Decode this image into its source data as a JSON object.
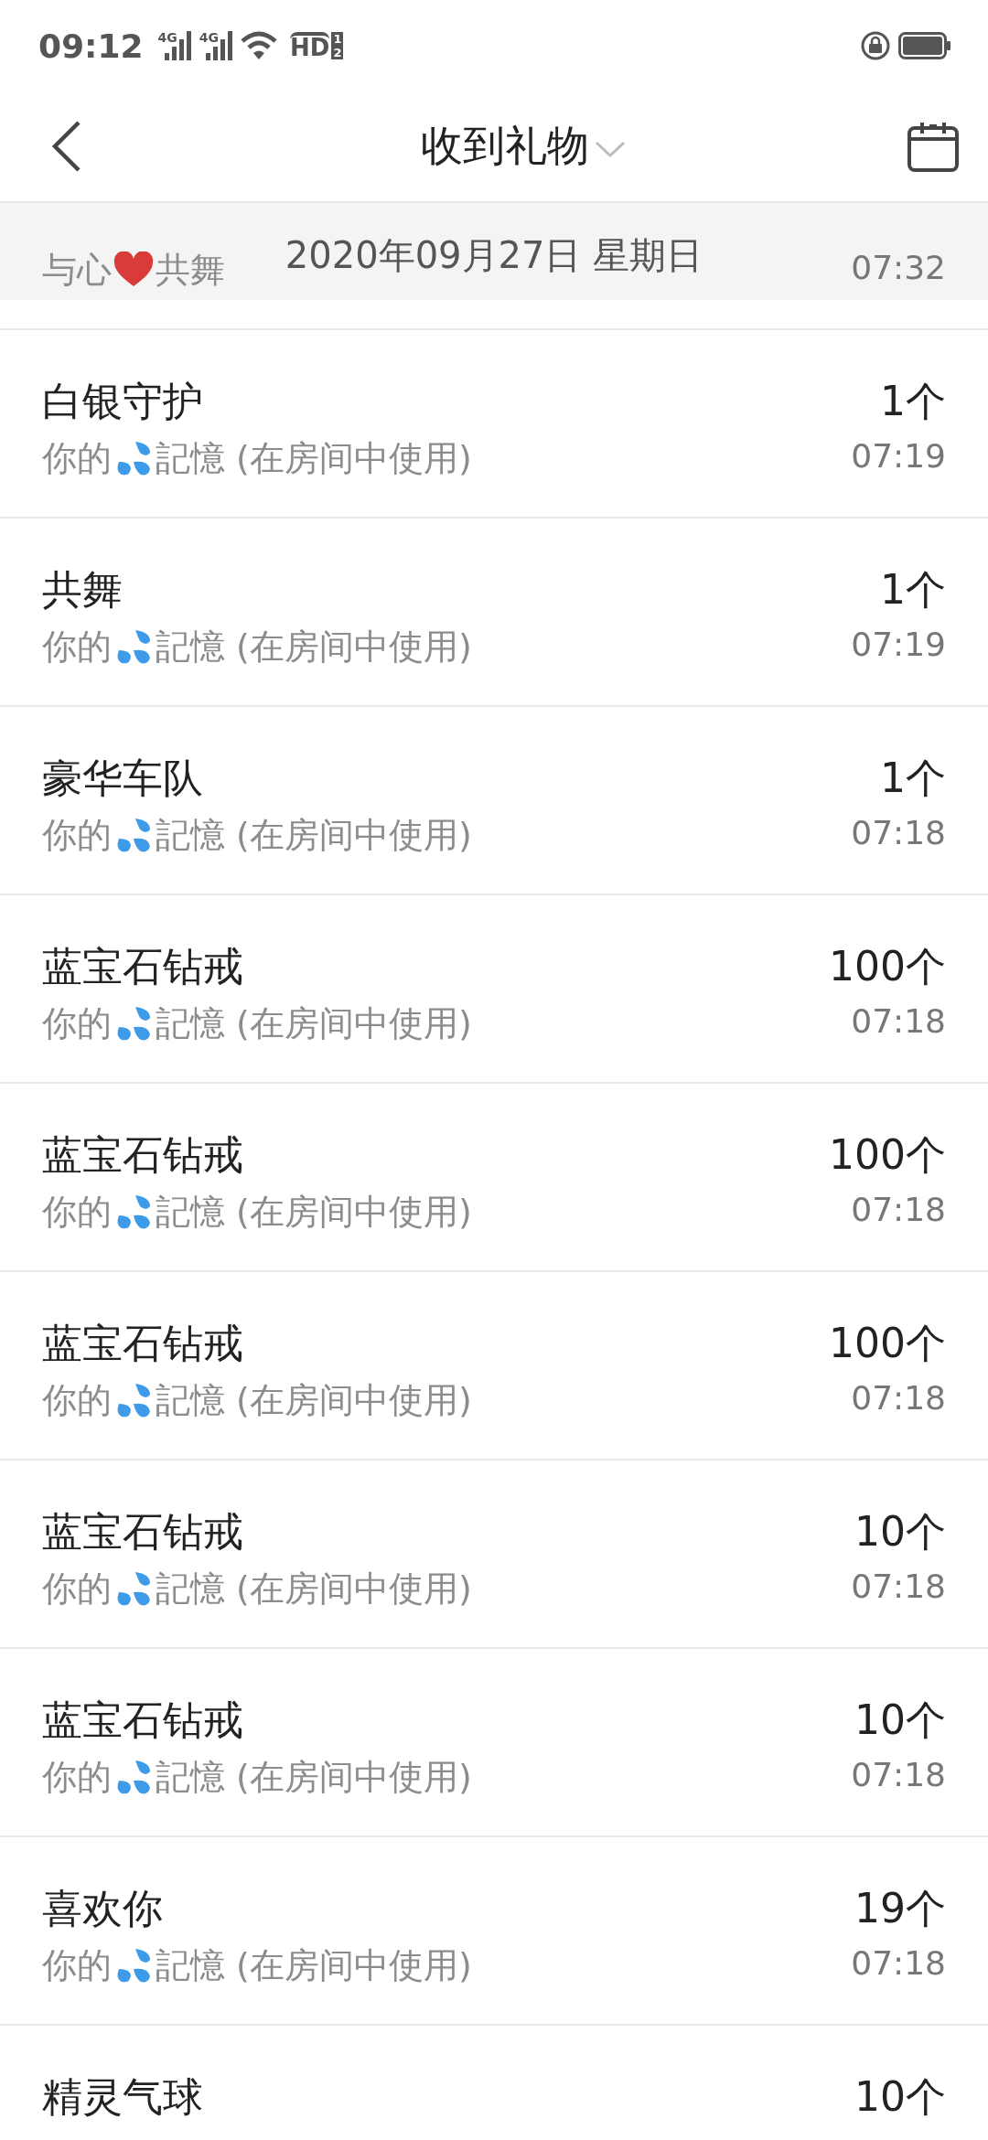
{
  "status_bar": {
    "time": "09:12",
    "sim_labels": [
      "4G",
      "4G"
    ],
    "call_label": "HD",
    "call_slots": [
      "1",
      "2"
    ]
  },
  "header": {
    "title": "收到礼物"
  },
  "date_bar": {
    "date": "2020年09月27日 星期日"
  },
  "gifts": [
    {
      "time": "07:32",
      "sender_before": "与心",
      "sender_icon": {
        "kind": "heart"
      },
      "sender_after": "共舞"
    },
    {
      "name": "白银守护",
      "count": "1个",
      "time": "07:19",
      "sender_before": "你的",
      "sender_icon": {
        "kind": "droplets"
      },
      "sender_after": "記憶 (在房间中使用)"
    },
    {
      "name": "共舞",
      "count": "1个",
      "time": "07:19",
      "sender_before": "你的",
      "sender_icon": {
        "kind": "droplets"
      },
      "sender_after": "記憶 (在房间中使用)"
    },
    {
      "name": "豪华车队",
      "count": "1个",
      "time": "07:18",
      "sender_before": "你的",
      "sender_icon": {
        "kind": "droplets"
      },
      "sender_after": "記憶 (在房间中使用)"
    },
    {
      "name": "蓝宝石钻戒",
      "count": "100个",
      "time": "07:18",
      "sender_before": "你的",
      "sender_icon": {
        "kind": "droplets"
      },
      "sender_after": "記憶 (在房间中使用)"
    },
    {
      "name": "蓝宝石钻戒",
      "count": "100个",
      "time": "07:18",
      "sender_before": "你的",
      "sender_icon": {
        "kind": "droplets"
      },
      "sender_after": "記憶 (在房间中使用)"
    },
    {
      "name": "蓝宝石钻戒",
      "count": "100个",
      "time": "07:18",
      "sender_before": "你的",
      "sender_icon": {
        "kind": "droplets"
      },
      "sender_after": "記憶 (在房间中使用)"
    },
    {
      "name": "蓝宝石钻戒",
      "count": "10个",
      "time": "07:18",
      "sender_before": "你的",
      "sender_icon": {
        "kind": "droplets"
      },
      "sender_after": "記憶 (在房间中使用)"
    },
    {
      "name": "蓝宝石钻戒",
      "count": "10个",
      "time": "07:18",
      "sender_before": "你的",
      "sender_icon": {
        "kind": "droplets"
      },
      "sender_after": "記憶 (在房间中使用)"
    },
    {
      "name": "喜欢你",
      "count": "19个",
      "time": "07:18",
      "sender_before": "你的",
      "sender_icon": {
        "kind": "droplets"
      },
      "sender_after": "記憶 (在房间中使用)"
    },
    {
      "name": "精灵气球",
      "count": "10个"
    }
  ]
}
